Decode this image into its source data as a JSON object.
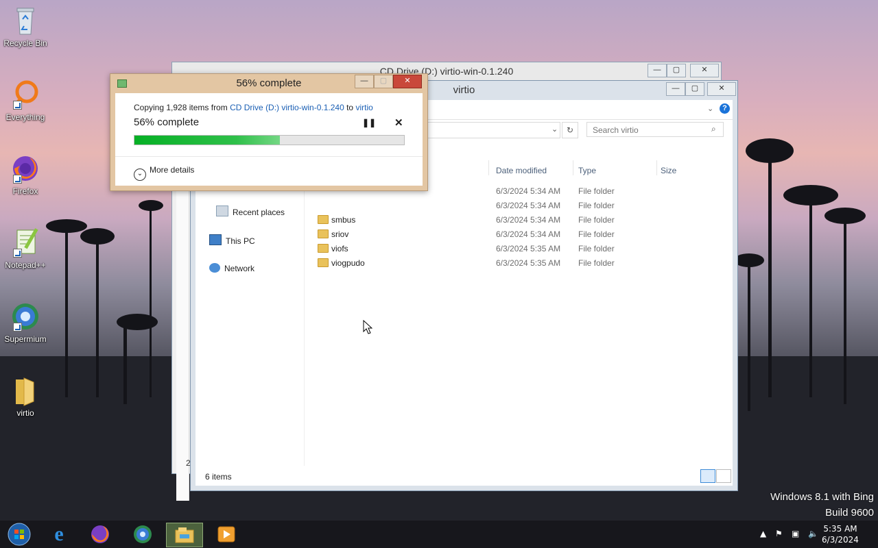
{
  "desktop": {
    "icons": [
      {
        "label": "Recycle Bin"
      },
      {
        "label": "Everything"
      },
      {
        "label": "Firefox"
      },
      {
        "label": "Notepad++"
      },
      {
        "label": "Supermium"
      },
      {
        "label": "virtio"
      }
    ]
  },
  "back_window": {
    "title": "CD Drive (D:) virtio-win-0.1.240",
    "status_partial": "2"
  },
  "explorer": {
    "title": "virtio",
    "search_placeholder": "Search virtio",
    "columns": {
      "date": "Date modified",
      "type": "Type",
      "size": "Size"
    },
    "nav": [
      {
        "label": "Recent places"
      },
      {
        "label": "This PC"
      },
      {
        "label": "Network"
      }
    ],
    "rows": [
      {
        "name": "",
        "date": "6/3/2024 5:34 AM",
        "type": "File folder"
      },
      {
        "name": "",
        "date": "6/3/2024 5:34 AM",
        "type": "File folder"
      },
      {
        "name": "smbus",
        "date": "6/3/2024 5:34 AM",
        "type": "File folder"
      },
      {
        "name": "sriov",
        "date": "6/3/2024 5:34 AM",
        "type": "File folder"
      },
      {
        "name": "viofs",
        "date": "6/3/2024 5:35 AM",
        "type": "File folder"
      },
      {
        "name": "viogpudo",
        "date": "6/3/2024 5:35 AM",
        "type": "File folder"
      }
    ],
    "status": "6 items"
  },
  "copy_dialog": {
    "title": "56% complete",
    "line1_prefix": "Copying 1,928 items from ",
    "source": "CD Drive (D:) virtio-win-0.1.240",
    "to_word": " to ",
    "dest": "virtio",
    "percent_text": "56% complete",
    "progress": 0.54,
    "more_details": "More details"
  },
  "watermark": {
    "line1": "Windows 8.1 with Bing",
    "line2": "Build 9600"
  },
  "taskbar": {
    "time": "5:35 AM",
    "date": "6/3/2024"
  },
  "colors": {
    "accent_green": "#06b025",
    "link_blue": "#1a5fb4",
    "dialog_frame": "#e3c6a3"
  }
}
